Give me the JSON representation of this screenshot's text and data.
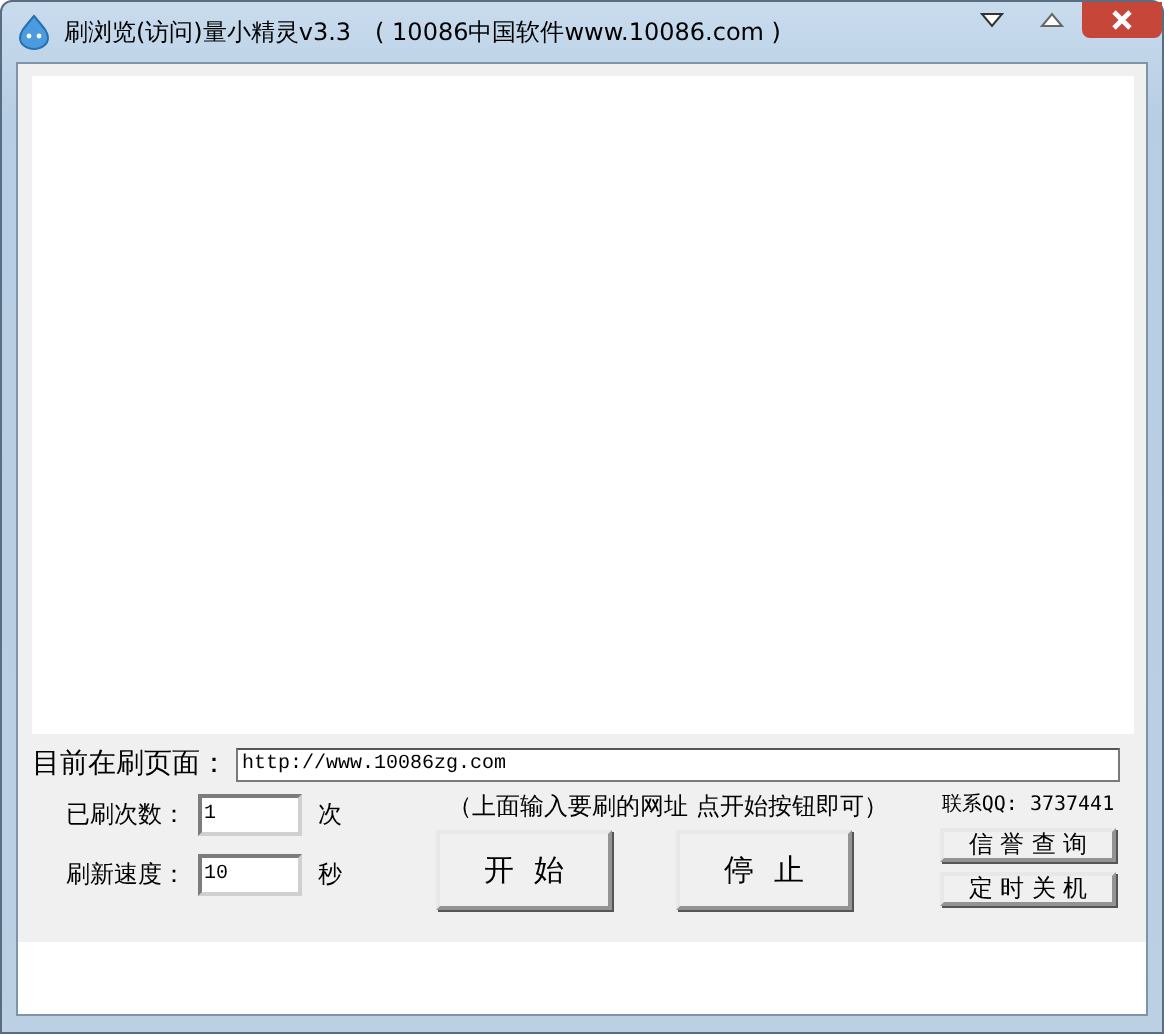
{
  "window": {
    "title": "刷浏览(访问)量小精灵v3.3　( 10086中国软件www.10086.com )"
  },
  "current_page": {
    "label": "目前在刷页面：",
    "value": "http://www.10086zg.com"
  },
  "count": {
    "label": "已刷次数：",
    "value": "1",
    "unit": "次"
  },
  "speed": {
    "label": "刷新速度：",
    "value": "10",
    "unit": "秒"
  },
  "hint": "（上面输入要刷的网址 点开始按钮即可）",
  "buttons": [
    {
      "label": "开  始"
    },
    {
      "label": "停  止"
    }
  ],
  "contact": "联系QQ: 3737441",
  "side_buttons": [
    {
      "label": "信 誉 查 询"
    },
    {
      "label": "定 时 关 机"
    }
  ]
}
